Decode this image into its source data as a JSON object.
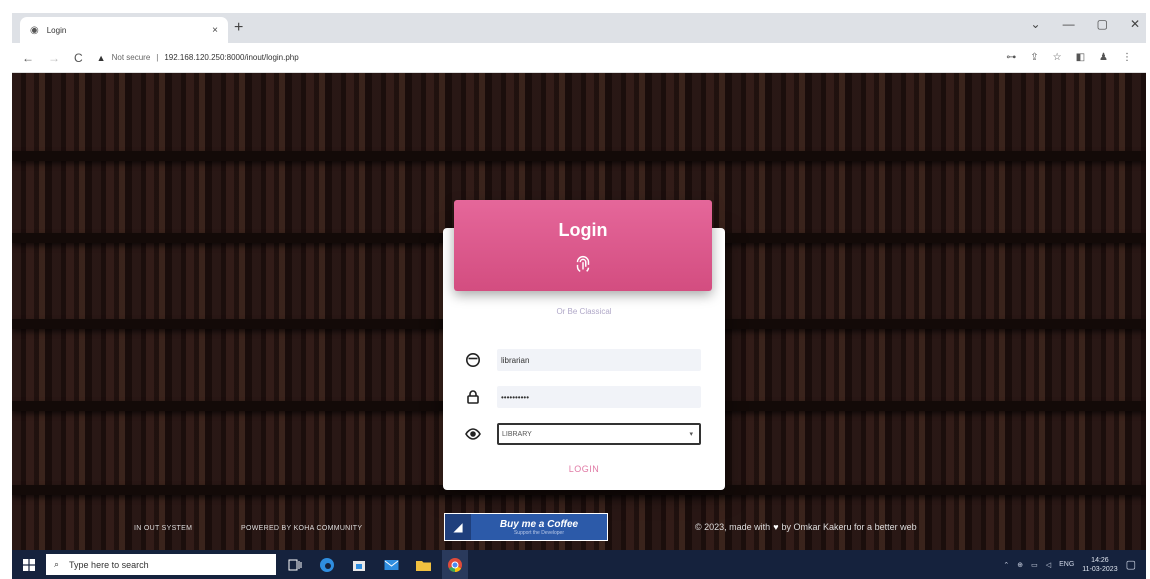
{
  "browser": {
    "tab_title": "Login",
    "tab_close": "×",
    "new_tab": "+",
    "security_label": "Not secure",
    "url": "192.168.120.250:8000/inout/login.php",
    "window_controls": [
      "⌄",
      "—",
      "▢",
      "✕"
    ]
  },
  "login": {
    "title": "Login",
    "subtitle": "Or Be Classical",
    "username_value": "librarian",
    "password_value": "••••••••••",
    "location_value": "LIBRARY",
    "submit_label": "LOGIN"
  },
  "footer": {
    "brand": "IN OUT SYSTEM",
    "powered_by": "POWERED BY KOHA COMMUNITY",
    "coffee_label": "Buy me a Coffee",
    "coffee_tagline": "Support the Developer",
    "credit_prefix": "© 2023, made with",
    "credit_suffix": "by Omkar Kakeru for a better web"
  },
  "taskbar": {
    "search_placeholder": "Type here to search",
    "language": "ENG",
    "time": "14:26",
    "date": "11-03-2023"
  },
  "colors": {
    "card_header": "#d94f86",
    "login_link": "#e07aa5",
    "coffee_button": "#2c5aa9",
    "taskbar": "#15223d"
  },
  "icons": [
    "globe-icon",
    "back-icon",
    "forward-icon",
    "reload-icon",
    "warning-icon",
    "key-icon",
    "share-icon",
    "star-icon",
    "sidebar-icon",
    "profile-icon",
    "menu-icon",
    "fingerprint-icon",
    "user-icon",
    "lock-icon",
    "eye-icon",
    "chevron-down-icon",
    "coffee-cup-icon",
    "heart-icon",
    "windows-icon",
    "search-icon",
    "task-view-icon",
    "edge-icon",
    "store-icon",
    "mail-icon",
    "folder-icon",
    "chrome-icon"
  ]
}
